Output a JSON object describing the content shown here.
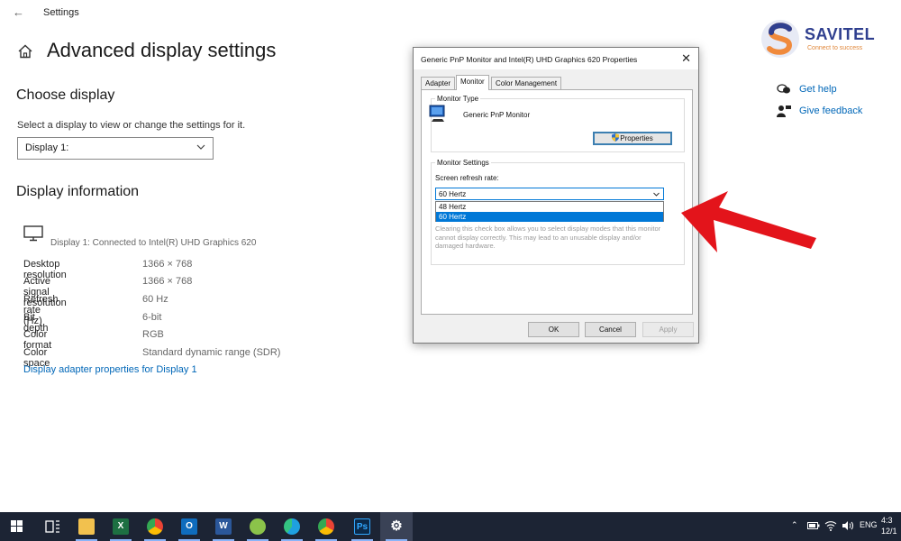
{
  "window": {
    "title": "Settings",
    "back_icon": "back-arrow-icon"
  },
  "page": {
    "title": "Advanced display settings",
    "choose_display": {
      "heading": "Choose display",
      "description": "Select a display to view or change the settings for it.",
      "selected": "Display 1:"
    },
    "display_information": {
      "heading": "Display information",
      "connected_text": "Display 1: Connected to Intel(R) UHD Graphics 620",
      "rows": [
        {
          "label": "Desktop resolution",
          "value": "1366 × 768"
        },
        {
          "label": "Active signal resolution",
          "value": "1366 × 768"
        },
        {
          "label": "Refresh rate (Hz)",
          "value": "60 Hz"
        },
        {
          "label": "Bit depth",
          "value": "6-bit"
        },
        {
          "label": "Color format",
          "value": "RGB"
        },
        {
          "label": "Color space",
          "value": "Standard dynamic range (SDR)"
        }
      ],
      "adapter_link": "Display adapter properties for Display 1"
    }
  },
  "help": {
    "get_help": "Get help",
    "give_feedback": "Give feedback"
  },
  "logo": {
    "name": "SAVITEL",
    "tagline": "Connect to success"
  },
  "dialog": {
    "title": "Generic PnP Monitor and Intel(R) UHD Graphics 620 Properties",
    "close": "✕",
    "tabs": [
      "Adapter",
      "Monitor",
      "Color Management"
    ],
    "active_tab": "Monitor",
    "monitor_type": {
      "group_title": "Monitor Type",
      "name": "Generic PnP Monitor",
      "properties_button": "Properties"
    },
    "monitor_settings": {
      "group_title": "Monitor Settings",
      "refresh_label": "Screen refresh rate:",
      "selected_rate": "60 Hertz",
      "options": [
        "48 Hertz",
        "60 Hertz"
      ],
      "highlighted_option": "60 Hertz",
      "hint": "Clearing this check box allows you to select display modes that this monitor cannot display correctly. This may lead to an unusable display and/or damaged hardware."
    },
    "buttons": {
      "ok": "OK",
      "cancel": "Cancel",
      "apply": "Apply"
    }
  },
  "annotation": {
    "arrow_color": "#e3141b"
  },
  "taskbar": {
    "icons": [
      {
        "name": "start-icon"
      },
      {
        "name": "task-view-icon"
      },
      {
        "name": "file-explorer-icon",
        "letter": "",
        "color": "#f2c14e"
      },
      {
        "name": "excel-icon",
        "letter": "X",
        "color": "#1d6f42"
      },
      {
        "name": "chrome-icon",
        "letter": "",
        "color": "#ea4335"
      },
      {
        "name": "outlook-icon",
        "letter": "O",
        "color": "#0f6cbd"
      },
      {
        "name": "word-icon",
        "letter": "W",
        "color": "#2b579a"
      },
      {
        "name": "app-green-icon",
        "letter": "",
        "color": "#8bc34a"
      },
      {
        "name": "edge-icon",
        "letter": "",
        "color": "#1fa0e0"
      },
      {
        "name": "chrome-icon-2",
        "letter": "",
        "color": "#ea4335"
      },
      {
        "name": "photoshop-icon",
        "letter": "Ps",
        "color": "#0b2a4a"
      },
      {
        "name": "settings-icon",
        "letter": "⚙",
        "color": "#3a4256"
      }
    ],
    "tray_language": "ENG",
    "clock_time": "4:3",
    "clock_date": "12/1"
  }
}
